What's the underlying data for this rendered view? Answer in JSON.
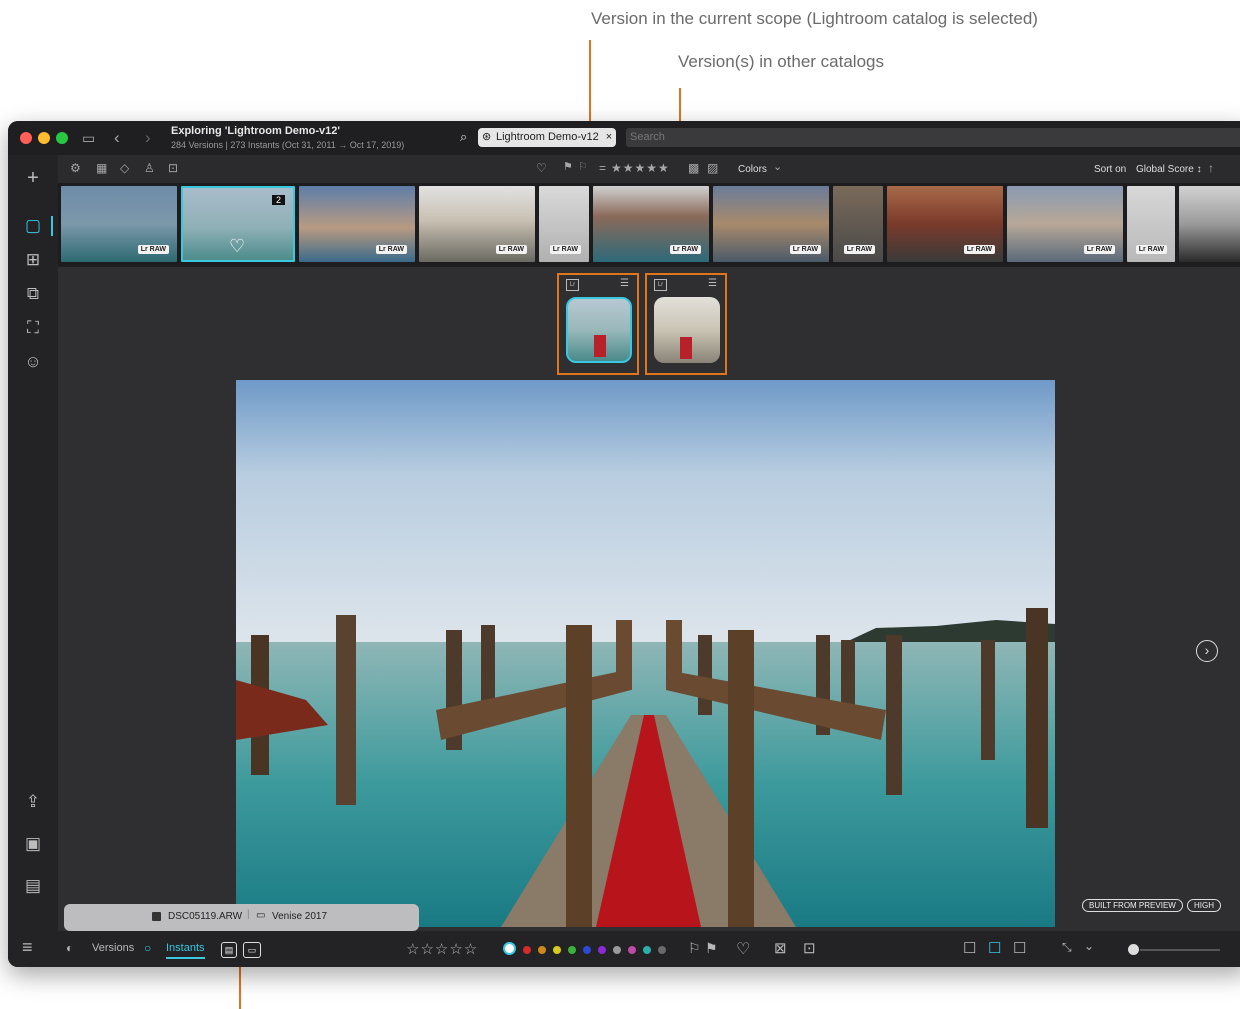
{
  "annotations": {
    "current_scope": "Version in the current scope (Lightroom catalog is selected)",
    "other_catalogs": "Version(s) in other catalogs",
    "accent": "#e0761b"
  },
  "window": {
    "title": "Exploring 'Lightroom Demo-v12'",
    "subtitle": "284 Versions | 273 Instants (Oct 31, 2011 → Oct 17, 2019)",
    "search_chip": "Lightroom Demo-v12",
    "search_placeholder": "Search"
  },
  "toolbar": {
    "colors_label": "Colors",
    "sort_prefix": "Sort on",
    "sort_value": "Global Score ↕",
    "rating_stars": "★★★★★"
  },
  "filmstrip": {
    "selected_count": "2",
    "badges": [
      "Lr RAW",
      "Lr RAW",
      "Lr RAW",
      "Lr RAW",
      "Lr RAW",
      "Lr RAW",
      "Lr RAW",
      "Lr RAW",
      "Lr RAW",
      "Lr RAW",
      "Lr RAW"
    ]
  },
  "versions": [
    {
      "tag": "Lr",
      "icon": "adjustments-icon"
    },
    {
      "tag": "Lr",
      "icon": "adjustments-icon"
    }
  ],
  "preview": {
    "built_from": "BUILT FROM PREVIEW",
    "quality": "HIGH"
  },
  "tooltip": {
    "filename": "DSC05119.ARW",
    "folder": "Venise 2017"
  },
  "bottombar": {
    "versions_label": "Versions",
    "instants_label": "Instants",
    "rating_empty": "☆☆☆☆☆",
    "color_labels": [
      "#ffffff",
      "#d42a2a",
      "#d08a1a",
      "#d6cc1e",
      "#3cb33c",
      "#2a4ad6",
      "#8a2ad6",
      "#9a9a9a",
      "#c04aa8",
      "#2ab0a8",
      "#6a6a6a"
    ]
  }
}
